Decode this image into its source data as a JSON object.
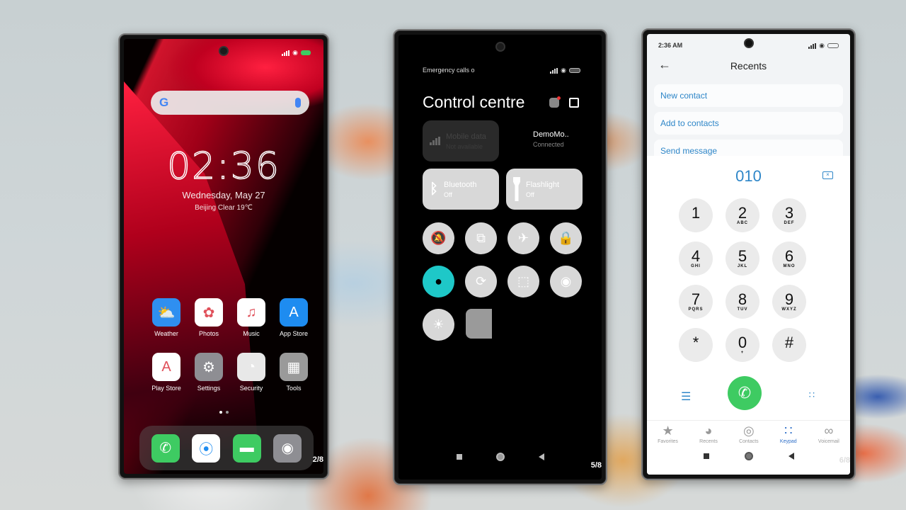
{
  "phone_home": {
    "status_icons": [
      "signal-icon",
      "wifi-icon",
      "battery-icon"
    ],
    "search_logo": "G",
    "clock": "02:36",
    "date": "Wednesday, May 27",
    "weather": "Beijing  Clear  19℃",
    "apps": [
      {
        "label": "Weather",
        "icon": "weather-icon",
        "glyph": "⛅",
        "bg": "#2f8ff0"
      },
      {
        "label": "Photos",
        "icon": "photos-icon",
        "glyph": "✿",
        "bg": "#ffffff"
      },
      {
        "label": "Music",
        "icon": "music-icon",
        "glyph": "♫",
        "bg": "#ffffff"
      },
      {
        "label": "App Store",
        "icon": "app-store-icon",
        "glyph": "A",
        "bg": "#1e8cf0"
      },
      {
        "label": "Play Store",
        "icon": "play-store-icon",
        "glyph": "A",
        "bg": "#ffffff"
      },
      {
        "label": "Settings",
        "icon": "settings-icon",
        "glyph": "⚙",
        "bg": "#8e8e93"
      },
      {
        "label": "Security",
        "icon": "security-icon",
        "glyph": "◔",
        "bg": "#e8e8e8"
      },
      {
        "label": "Tools",
        "icon": "tools-folder-icon",
        "glyph": "▦",
        "bg": "#9a9a9a"
      }
    ],
    "dock": [
      {
        "icon": "phone-icon",
        "glyph": "✆",
        "bg": "#3ecb62"
      },
      {
        "icon": "safari-icon",
        "glyph": "⦿",
        "bg": "#ffffff"
      },
      {
        "icon": "messages-icon",
        "glyph": "▬",
        "bg": "#3ecb62"
      },
      {
        "icon": "camera-icon",
        "glyph": "◉",
        "bg": "#8e8e93"
      }
    ],
    "page_indicator": "2/8"
  },
  "phone_control": {
    "status_text": "Emergency calls o",
    "title": "Control centre",
    "tiles": {
      "mobile_data": {
        "title": "Mobile data",
        "sub": "Not available"
      },
      "wifi": {
        "title": "DemoMo..",
        "sub": "Connected"
      },
      "bluetooth": {
        "title": "Bluetooth",
        "sub": "Off"
      },
      "flashlight": {
        "title": "Flashlight",
        "sub": "Off"
      }
    },
    "toggles": [
      {
        "name": "mute-icon",
        "glyph": "🔕",
        "active": false
      },
      {
        "name": "screenshot-icon",
        "glyph": "⧉",
        "active": false
      },
      {
        "name": "airplane-mode-icon",
        "glyph": "✈",
        "active": false
      },
      {
        "name": "lock-icon",
        "glyph": "🔒",
        "active": false
      },
      {
        "name": "location-icon",
        "glyph": "●",
        "active": true
      },
      {
        "name": "rotation-lock-icon",
        "glyph": "⟳",
        "active": false
      },
      {
        "name": "scanner-icon",
        "glyph": "⬚",
        "active": false
      },
      {
        "name": "reading-mode-icon",
        "glyph": "◉",
        "active": false
      },
      {
        "name": "brightness-icon",
        "glyph": "☀",
        "active": false
      }
    ],
    "accent_color": "#1ec8c8",
    "page_indicator": "5/8"
  },
  "phone_dialer": {
    "time": "2:36 AM",
    "header": "Recents",
    "actions": [
      "New contact",
      "Add to contacts",
      "Send message"
    ],
    "dialed_number": "010",
    "keys": [
      {
        "d": "1",
        "l": ""
      },
      {
        "d": "2",
        "l": "ABC"
      },
      {
        "d": "3",
        "l": "DEF"
      },
      {
        "d": "4",
        "l": "GHI"
      },
      {
        "d": "5",
        "l": "JKL"
      },
      {
        "d": "6",
        "l": "MNO"
      },
      {
        "d": "7",
        "l": "PQRS"
      },
      {
        "d": "8",
        "l": "TUV"
      },
      {
        "d": "9",
        "l": "WXYZ"
      },
      {
        "d": "*",
        "l": ""
      },
      {
        "d": "0",
        "l": "+"
      },
      {
        "d": "#",
        "l": ""
      }
    ],
    "tabs": [
      {
        "label": "Favorites",
        "icon": "star-icon",
        "glyph": "★",
        "active": false
      },
      {
        "label": "Recents",
        "icon": "clock-icon",
        "glyph": "◕",
        "active": false
      },
      {
        "label": "Contacts",
        "icon": "contacts-icon",
        "glyph": "◎",
        "active": false
      },
      {
        "label": "Keypad",
        "icon": "keypad-icon",
        "glyph": "∷",
        "active": true
      },
      {
        "label": "Voicemail",
        "icon": "voicemail-icon",
        "glyph": "∞",
        "active": false
      }
    ],
    "accent_color": "#2e86c8",
    "call_color": "#3ecb62",
    "page_indicator": "6/8"
  }
}
